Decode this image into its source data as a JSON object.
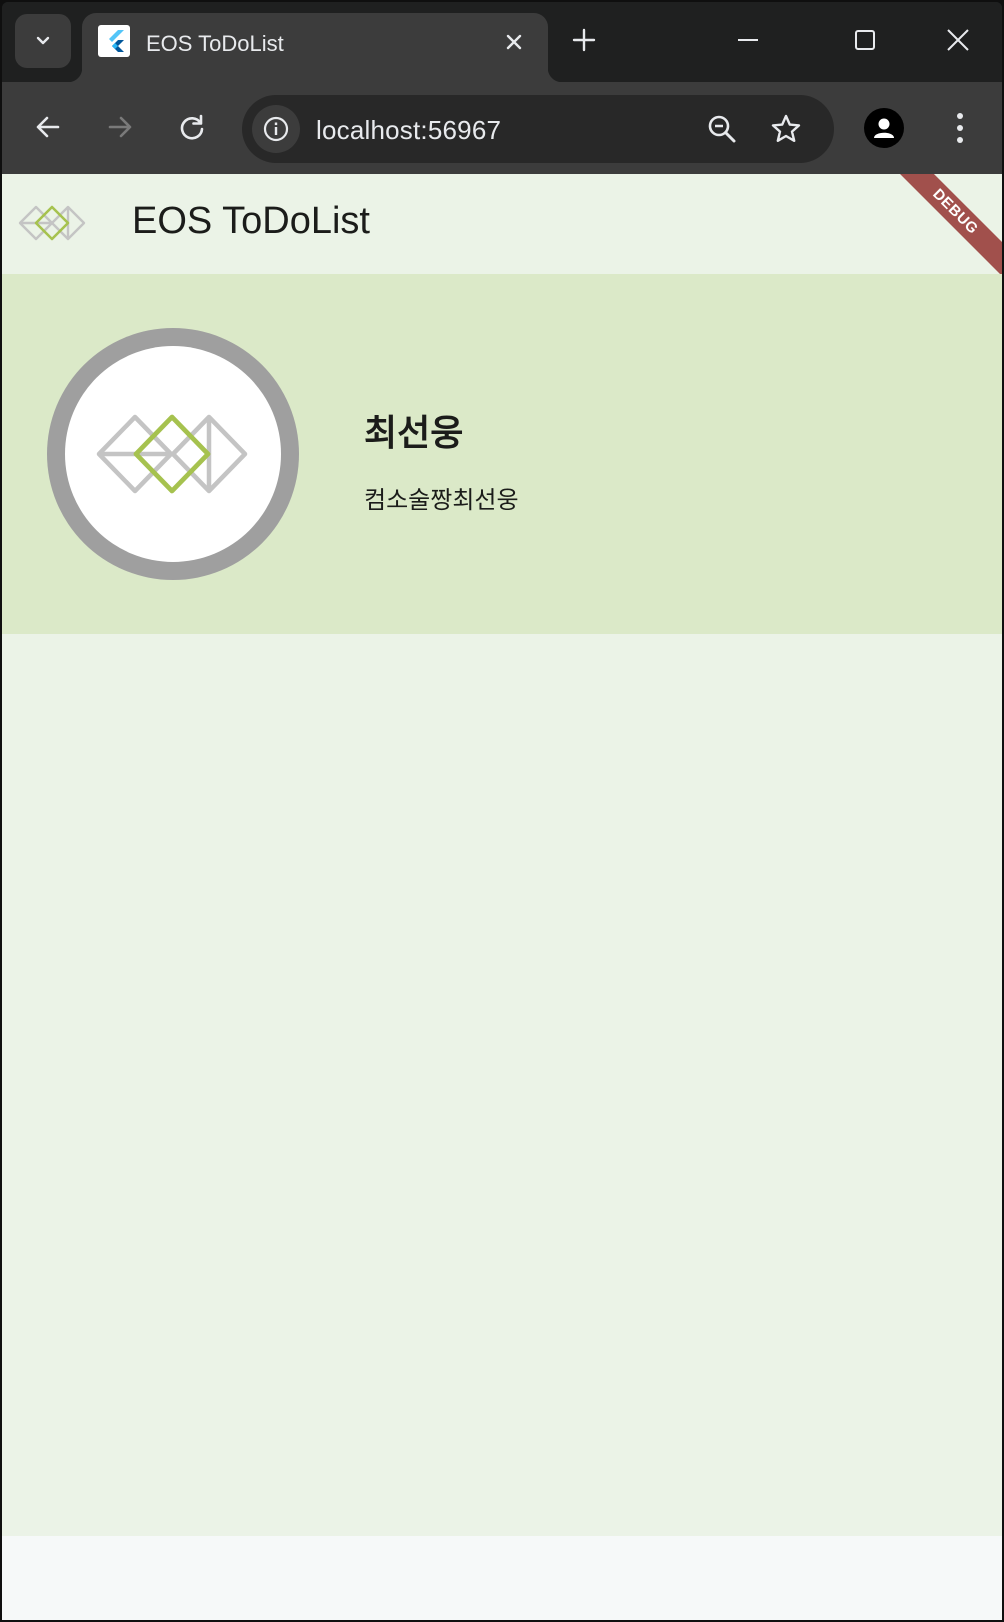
{
  "browser": {
    "tab": {
      "title": "EOS  ToDoList"
    },
    "address_bar": {
      "url": "localhost:56967"
    }
  },
  "app": {
    "title": "EOS ToDoList",
    "debug_banner": "DEBUG",
    "profile": {
      "name": "최선웅",
      "subtitle": "컴소술짱최선웅"
    }
  },
  "colors": {
    "appbar_bg": "#ebf3e7",
    "profile_bg": "#dbe9c8",
    "logo_green": "#a6c24f",
    "logo_gray": "#c4c4c4",
    "debug_red": "#a1504c"
  }
}
